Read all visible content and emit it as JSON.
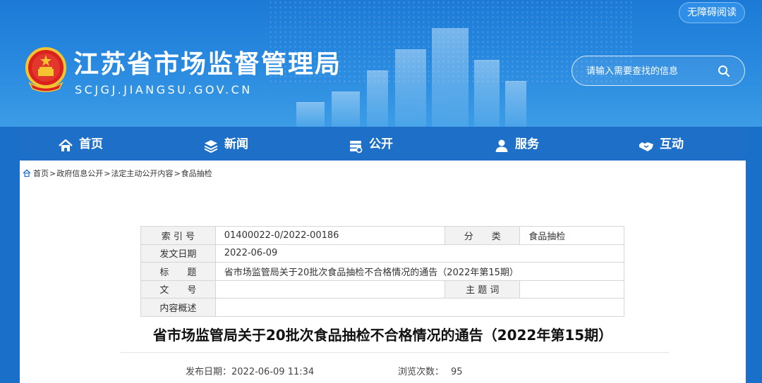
{
  "header": {
    "accessibility_label": "无障碍阅读",
    "site_title": "江苏省市场监督管理局",
    "site_domain": "SCJGJ.JIANGSU.GOV.CN",
    "search_placeholder": "请输入需要查找的信息",
    "colors": {
      "banner": "#1c7ad6",
      "nav": "#1d6fc7"
    }
  },
  "nav": {
    "items": [
      {
        "label": "首页",
        "icon": "home-icon"
      },
      {
        "label": "新闻",
        "icon": "layers-icon"
      },
      {
        "label": "公开",
        "icon": "document-stack-icon"
      },
      {
        "label": "服务",
        "icon": "user-icon"
      },
      {
        "label": "互动",
        "icon": "handshake-icon"
      }
    ]
  },
  "breadcrumb": {
    "items": [
      "首页",
      "政府信息公开",
      "法定主动公开内容",
      "食品抽检"
    ],
    "separator": ">"
  },
  "meta": {
    "index_label": "索 引 号",
    "index_value": "01400022-0/2022-00186",
    "category_label": "分　　类",
    "category_value": "食品抽检",
    "date_label": "发文日期",
    "date_value": "2022-06-09",
    "title_label": "标　　题",
    "title_value": "省市场监管局关于20批次食品抽检不合格情况的通告（2022年第15期）",
    "docno_label": "文　　号",
    "docno_value": "",
    "topic_label": "主 题 词",
    "topic_value": "",
    "summary_label": "内容概述",
    "summary_value": ""
  },
  "article": {
    "title": "省市场监管局关于20批次食品抽检不合格情况的通告（2022年第15期）",
    "publish_label": "发布日期：",
    "publish_time": "2022-06-09 11:34",
    "views_label": "浏览次数：",
    "views_count": "95"
  }
}
